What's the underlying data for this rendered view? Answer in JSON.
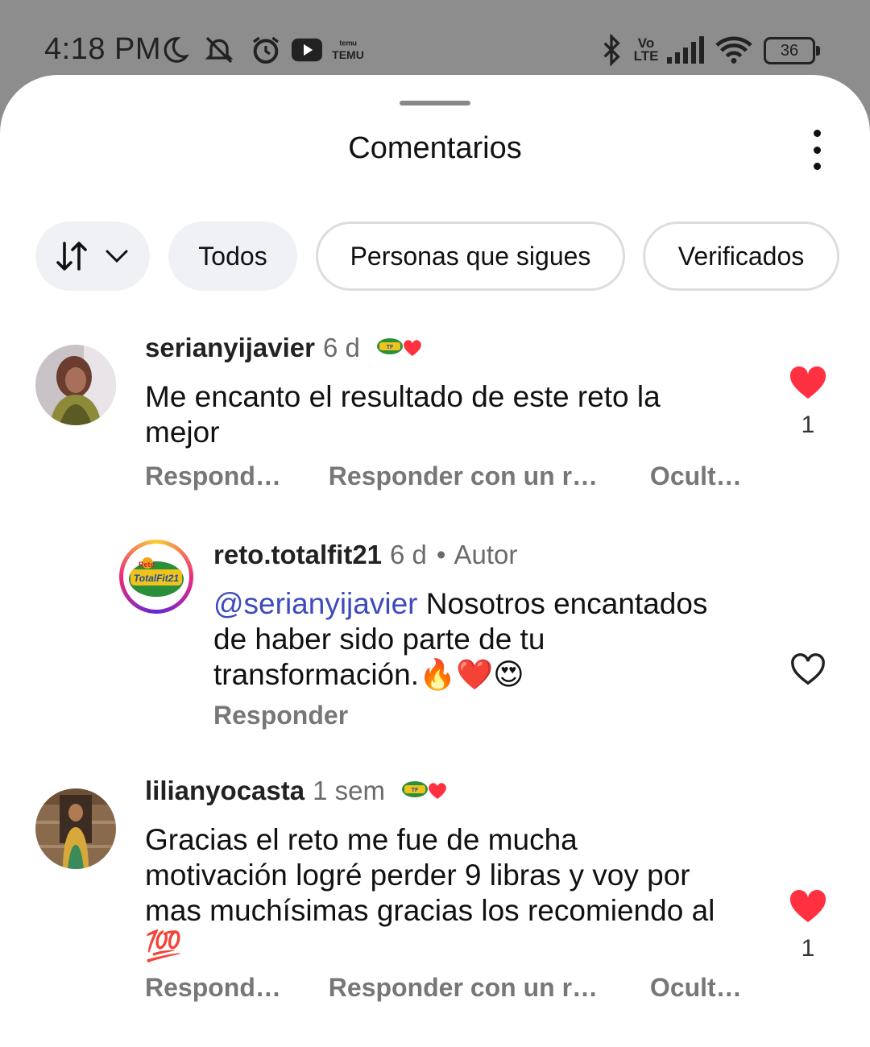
{
  "status_bar": {
    "time": "4:18 PM",
    "icons": [
      "moon-icon",
      "notifications-off-icon",
      "alarm-icon",
      "youtube-icon",
      "temu-icon",
      "bluetooth-icon",
      "volte-icon",
      "signal-icon",
      "wifi-icon"
    ],
    "temu_label_top": "ᵗᵉᵐᵘ",
    "temu_label": "TEMU",
    "volte_top": "Vo",
    "volte_bottom": "LTE",
    "battery": "36"
  },
  "sheet": {
    "title": "Comentarios",
    "menu_icon": "more-vertical-icon"
  },
  "filters": {
    "sort_icon": "sort-arrows-icon",
    "chips": [
      "Todos",
      "Personas que sigues",
      "Verificados"
    ]
  },
  "comments": [
    {
      "username": "serianyijavier",
      "time": "6 d",
      "text": "Me encanto el resultado de este reto la mejor",
      "actions": [
        "Respond…",
        "Responder con un r…",
        "Ocult…"
      ],
      "liked": true,
      "like_count": "1"
    },
    {
      "username": "reto.totalfit21",
      "time": "6 d",
      "author_label": "Autor",
      "mention": "@serianyijavier",
      "text": " Nosotros encantados de haber sido parte de tu transformación.🔥❤️😍",
      "actions": [
        "Responder"
      ],
      "liked": false
    },
    {
      "username": "lilianyocasta",
      "time": "1 sem",
      "text": "Gracias el reto me fue de mucha motivación logré perder 9 libras y voy por mas muchísimas gracias los recomiendo al 💯",
      "actions": [
        "Respond…",
        "Responder con un r…",
        "Ocult…"
      ],
      "liked": true,
      "like_count": "1"
    }
  ],
  "colors": {
    "like_red": "#ff3040",
    "mention_blue": "#3d4bbd"
  }
}
